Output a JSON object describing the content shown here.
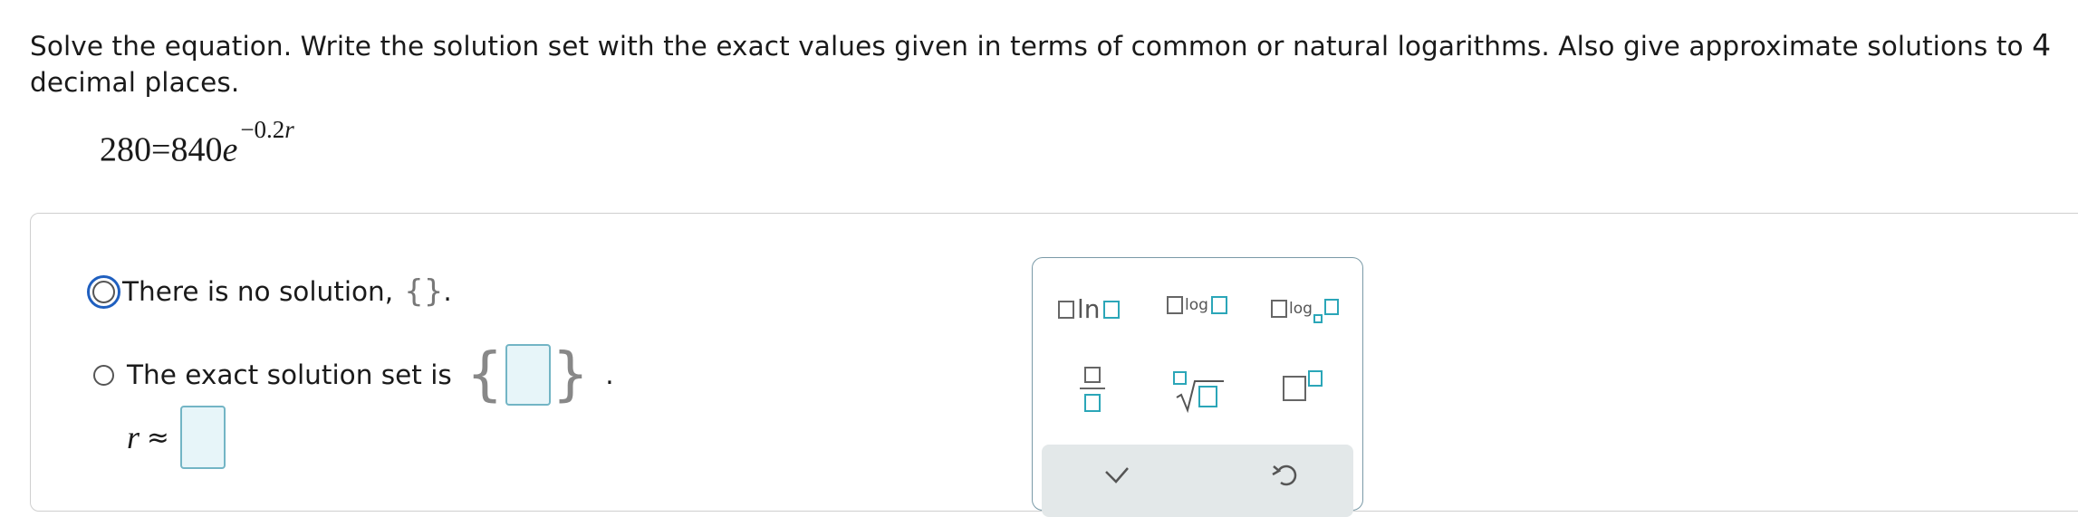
{
  "prompt": {
    "text_before": "Solve the equation. Write the solution set with the exact values given in terms of common or natural logarithms. Also give approximate solutions to ",
    "decimals": "4",
    "text_after": " decimal places."
  },
  "equation": {
    "lhs": "280",
    "equals": "=",
    "coefficient": "840",
    "base": "e",
    "exponent_coef": "−0.2",
    "exponent_var": "r"
  },
  "options": [
    {
      "label": "There is no solution,",
      "symbol": "{}",
      "end": ".",
      "selected": false
    },
    {
      "label": "The exact solution set is",
      "open": "{",
      "close": "}",
      "end": ".",
      "value": ""
    }
  ],
  "approx": {
    "variable": "r",
    "symbol": "≈",
    "value": ""
  },
  "palette": {
    "ln_label": "ln",
    "log_label": "log",
    "logb_label": "log",
    "buttons": [
      "ln-button",
      "log-button",
      "log-base-button",
      "fraction-button",
      "nth-root-button",
      "exponent-button"
    ],
    "actions": [
      "check-icon",
      "undo-icon"
    ]
  },
  "colors": {
    "input_border": "#73b5c5",
    "input_fill": "#e7f5f9",
    "palette_teal": "#2ba6b8",
    "focus_ring": "#1f5fbf"
  }
}
